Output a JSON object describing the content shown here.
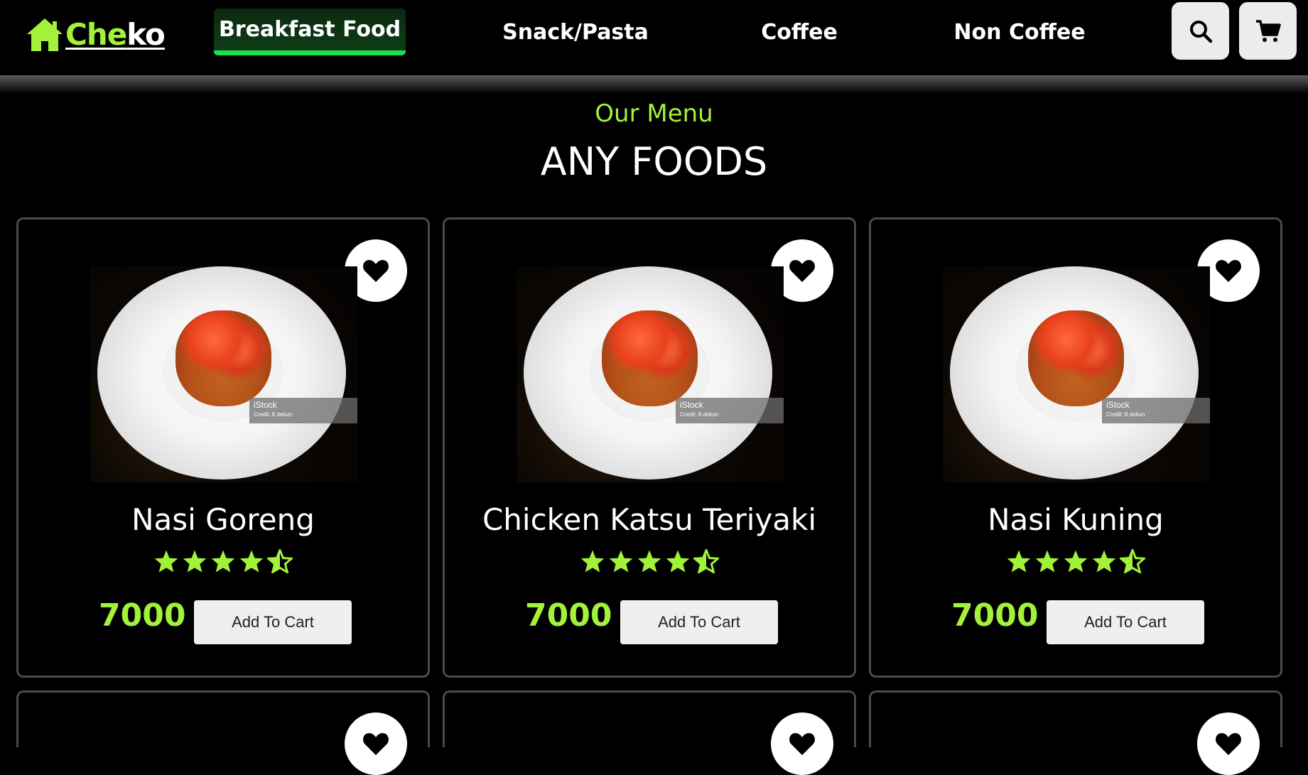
{
  "brand": {
    "logo_part1": "Che",
    "logo_part2": "ko",
    "accent_color": "#a3f23a",
    "active_nav_color": "#1ae34a"
  },
  "nav": {
    "items": [
      {
        "label": "Breakfast Food",
        "active": true
      },
      {
        "label": "Snack/Pasta",
        "active": false
      },
      {
        "label": "Coffee",
        "active": false
      },
      {
        "label": "Non Coffee",
        "active": false
      }
    ],
    "icons": [
      "search-icon",
      "cart-icon"
    ]
  },
  "menu": {
    "subtitle": "Our Menu",
    "title": "ANY FOODS"
  },
  "cards": [
    {
      "name": "Nasi Goreng",
      "rating": 4.5,
      "price": "7000",
      "button_label": "Add To Cart",
      "image_watermark": "iStock",
      "image_credit": "Credit: 8 dekun"
    },
    {
      "name": "Chicken Katsu Teriyaki",
      "rating": 4.5,
      "price": "7000",
      "button_label": "Add To Cart",
      "image_watermark": "iStock",
      "image_credit": "Credit: 8 dekun"
    },
    {
      "name": "Nasi Kuning",
      "rating": 4.5,
      "price": "7000",
      "button_label": "Add To Cart",
      "image_watermark": "iStock",
      "image_credit": "Credit: 8 dekun"
    }
  ]
}
